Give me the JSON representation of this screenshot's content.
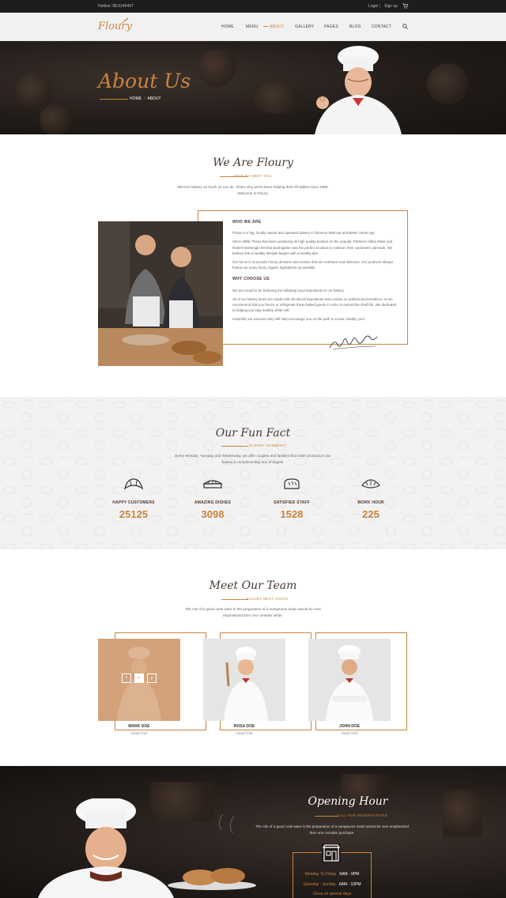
{
  "topbar": {
    "hotline": "Hotline: 88.6249497",
    "login": "Login",
    "signup": "Sign up"
  },
  "brand": {
    "logo": "Floury"
  },
  "nav": {
    "items": [
      {
        "label": "HOME"
      },
      {
        "label": "MENU"
      },
      {
        "label": "ABOUT"
      },
      {
        "label": "GALLERY"
      },
      {
        "label": "PAGES"
      },
      {
        "label": "BLOG"
      },
      {
        "label": "CONTACT"
      }
    ],
    "active": "ABOUT"
  },
  "hero": {
    "title": "About Us",
    "crumb_home": "HOME",
    "crumb_sep": "/",
    "crumb_current": "ABOUT"
  },
  "intro": {
    "title": "We Are Floury",
    "subtitle": "NICE TO MEET YOU",
    "desc_1": "We love bakery as much as you do. That's why we've been helping them fill tables since 1999.",
    "desc_2": "Welcome to Floury."
  },
  "about": {
    "who_heading": "WHO WE ARE",
    "who_p1": "Floury is a fag, locally owned and operated bakery in Shoreun Wall Apt and Baker Street Apt.",
    "who_p2": "Since 1999, Floury has been producing its high quality product on the popular. Partners Hilma Mawr and Robert McMongle felt that Burlingame was the perfect location to continue their customers old trade. We believe that a healthy lifestyle begins with a healthy diet.",
    "who_p3": "Our focus is to provide Floury desserts and snacks that are nutritious and delicious. Our products always feature as many local, organic ingredients as possible.",
    "why_heading": "WHY CHOOSE US",
    "why_p1": "We are proud to be featuring the following local ingredients in our bakery.",
    "why_p2": "All of our bakery items are made with all-natural ingredients and contain no artificial preservatives, so we recommend that you freeze or refrigerate these baked goods in order to extend the shelf life. We dedicated to helping you stay healthy while still.",
    "why_p3": "Hopefully we success story will help encourage you on the path to a new, healthy you!"
  },
  "funfact": {
    "title": "Our Fun Fact",
    "subtitle": "FLOURY NUMBERS",
    "desc_1": "Every Monday, Tuesday and Wednesday, we offer couples and families that order products in our",
    "desc_2": "bakery a complimentary box of bagels.",
    "items": [
      {
        "label": "HAPPY CUSTOMERS",
        "value": "25125",
        "icon": "croissant-icon"
      },
      {
        "label": "AMAZING DISHES",
        "value": "3098",
        "icon": "pie-icon"
      },
      {
        "label": "SATISFIED STAFF",
        "value": "1528",
        "icon": "bread-icon"
      },
      {
        "label": "WORK HOUR",
        "value": "225",
        "icon": "pastry-icon"
      }
    ]
  },
  "team": {
    "title": "Meet Our Team",
    "subtitle": "FLOURY BEST CHEFS",
    "desc_1": "The role of a good cook ware in the preparation of a sumptuous meal cannot be over",
    "desc_2": "emphasized then one consider white.",
    "members": [
      {
        "name": "MARK DOE",
        "role": "Head Chef"
      },
      {
        "name": "ROSA DOE",
        "role": "Head Chef"
      },
      {
        "name": "JOHN DOE",
        "role": "Head Chef"
      }
    ],
    "social": [
      "f",
      "t",
      "p"
    ]
  },
  "opening": {
    "title": "Opening Hour",
    "subtitle": "CALL FOR RESERVATIONS",
    "desc": "The role of a good cook ware in the preparation of a sumptuous meal cannot be over emphasized then one consider purchase.",
    "rows": [
      {
        "day": "Monday To Friday",
        "time": "6AM - 9PM"
      },
      {
        "day": "Saturday - Sunday",
        "time": "6AM - 10PM"
      }
    ],
    "closed": "Close on special days"
  },
  "colors": {
    "accent": "#c7843f",
    "dark": "#1d1d1d",
    "heading": "#4a3a33"
  }
}
